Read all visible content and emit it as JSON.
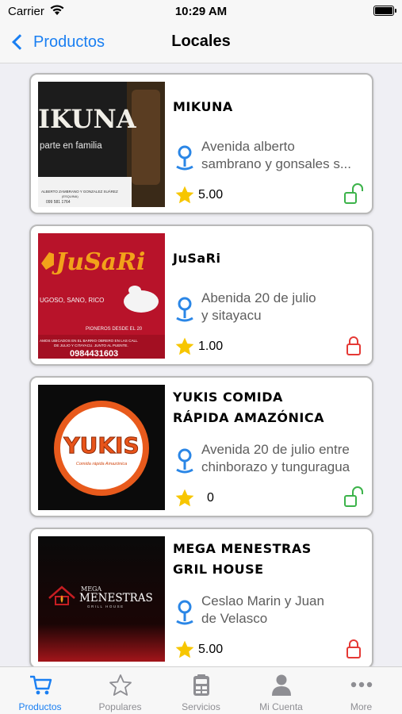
{
  "status_bar": {
    "carrier": "Carrier",
    "time": "10:29 AM"
  },
  "nav": {
    "back_label": "Productos",
    "title": "Locales"
  },
  "locales": [
    {
      "name_lines": [
        "MIKUNA"
      ],
      "address_lines": [
        "Avenida alberto",
        "sambrano y gonsales s..."
      ],
      "rating": "5.00",
      "lock": "unlocked",
      "image": {
        "logo": "IKUNA",
        "tagline": "parte en familia",
        "footer": "ALBERTO ZAMBRANO Y GONZALEZ SUÁREZ",
        "footer2": "(ESQUINA)",
        "phone": "099 581 1764"
      }
    },
    {
      "name_lines": [
        "JuSaRi"
      ],
      "address_lines": [
        "Abenida 20 de julio",
        "y sitayacu"
      ],
      "rating": "1.00",
      "lock": "locked",
      "image": {
        "logo": "JuSaRi",
        "tagline": "UGOSO, SANO, RICO",
        "subtag": "PIONEROS DESDE EL 20",
        "footer": "AMOS UBICADOS EN EL BARRIO OBRERO EN LAS CALL",
        "footer2": "DE JULIO Y CITAYACU. JUNTO AL PUENTE.",
        "phone": "0984431603"
      }
    },
    {
      "name_lines": [
        "YUKIS COMIDA",
        "RÁPIDA AMAZÓNICA"
      ],
      "address_lines": [
        "Avenida 20 de julio entre",
        "chinborazo y tunguragua"
      ],
      "rating": "0",
      "lock": "unlocked",
      "image": {
        "logo": "YUKIS",
        "tagline": "Comida rápida Amazónica"
      }
    },
    {
      "name_lines": [
        "MEGA MENESTRAS",
        "GRIL HOUSE"
      ],
      "address_lines": [
        "Ceslao Marin y Juan",
        "de Velasco"
      ],
      "rating": "5.00",
      "lock": "locked",
      "image": {
        "logo_small": "MEGA",
        "logo": "MENESTRAS",
        "tagline": "GRILL HOUSE"
      }
    }
  ],
  "tabs": [
    {
      "label": "Productos",
      "icon": "cart-icon",
      "active": true
    },
    {
      "label": "Populares",
      "icon": "star-outline-icon",
      "active": false
    },
    {
      "label": "Servicios",
      "icon": "services-icon",
      "active": false
    },
    {
      "label": "Mi Cuenta",
      "icon": "person-icon",
      "active": false
    },
    {
      "label": "More",
      "icon": "more-icon",
      "active": false
    }
  ],
  "colors": {
    "accent": "#1a7ff2",
    "lock_locked": "#e53935",
    "lock_unlocked": "#3cb34a",
    "star": "#f7c600",
    "pin": "#2a86e6"
  }
}
